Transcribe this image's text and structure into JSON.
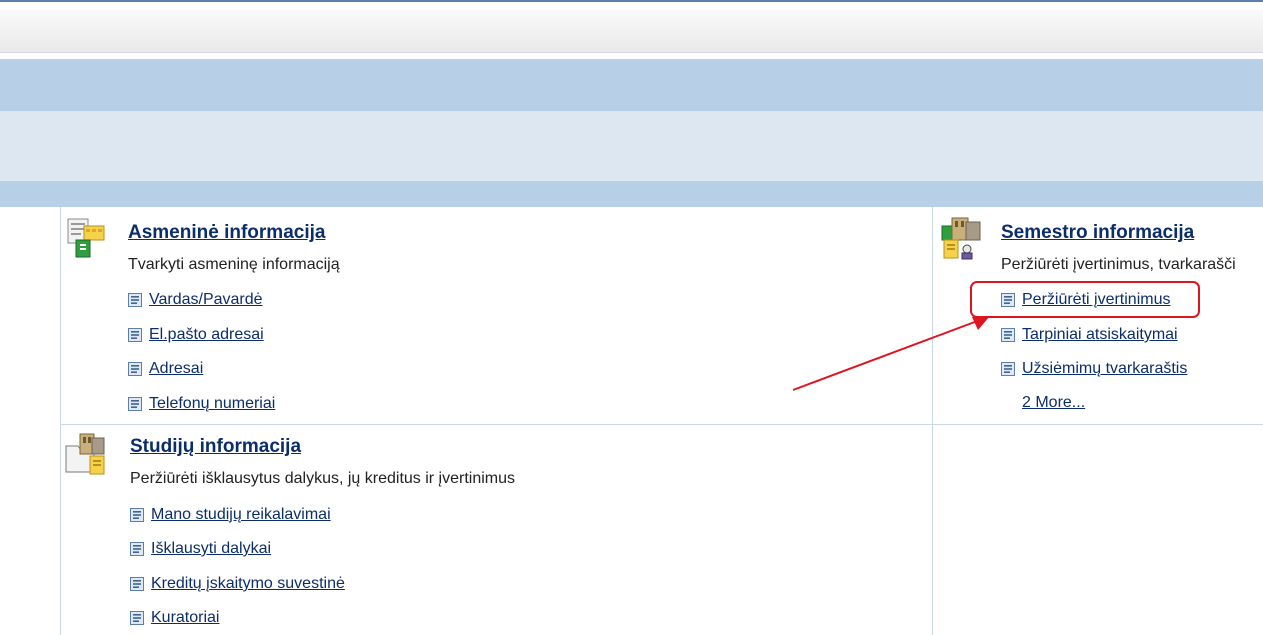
{
  "annotation": {
    "color": "#e0141e"
  },
  "groups": [
    {
      "title": "Asmeninė informacija",
      "description": "Tvarkyti asmeninę informaciją",
      "links": [
        "Vardas/Pavardė",
        "El.pašto adresai",
        "Adresai",
        "Telefonų numeriai"
      ],
      "icon": "personal-info-icon"
    },
    {
      "title": "Semestro informacija",
      "description": "Peržiūrėti įvertinimus, tvarkarašči",
      "links": [
        "Peržiūrėti įvertinimus",
        "Tarpiniai atsiskaitymai",
        "Užsiėmimų tvarkaraštis"
      ],
      "more": "2 More...",
      "icon": "semester-info-icon"
    },
    {
      "title": "Studijų informacija",
      "description": "Peržiūrėti išklausytus dalykus, jų kreditus ir įvertinimus",
      "links": [
        "Mano studijų reikalavimai",
        "Išklausyti dalykai",
        "Kreditų įskaitymo suvestinė",
        "Kuratoriai"
      ],
      "icon": "study-info-icon"
    }
  ],
  "colors": {
    "link": "#0b2e6b",
    "band_dark": "#b8d0e7",
    "band_light": "#dce7f1"
  }
}
